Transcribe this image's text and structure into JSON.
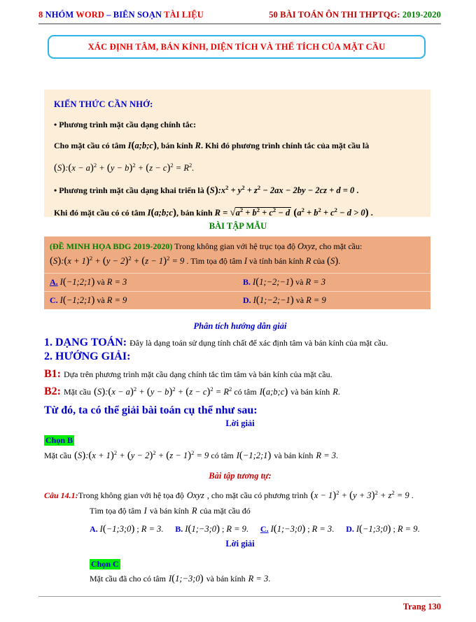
{
  "header": {
    "left_icon": "8",
    "left_part1": "NHÓM",
    "left_part2": "WORD",
    "left_dash": "–",
    "left_part3": "BIÊN SOẠN",
    "left_part4": "TÀI LIỆU",
    "right_main": "50 BÀI TOÁN ÔN THI THPTQG:",
    "right_years": "2019-2020"
  },
  "title_box": {
    "text": "XÁC ĐỊNH TÂM, BÁN KÍNH, DIỆN TÍCH VÀ THỂ TÍCH CỦA MẶT CẦU",
    "border_color": "#2eb2e8",
    "text_color": "#ee0000"
  },
  "knowledge": {
    "heading": "KIẾN THỨC CẦN NHỚ:",
    "bullet1": "• Phương trình mặt cầu dạng chính tắc:",
    "line_center_radius_pre": "Cho mặt cầu có tâm",
    "line_center_I": "I(a;b;c)",
    "line_center_mid": ", bán kính",
    "line_center_R": "R",
    "line_center_post": ". Khi đó phương trình chính tắc của mặt cầu là",
    "equation_canonical": "(S):(x−a)² + (y−b)² + (z−c)² = R².",
    "bullet2_pre": "• Phương trình mặt cầu dạng khai triển là",
    "equation_general": "(S):x² + y² + z² − 2ax − 2by − 2cz + d = 0 .",
    "line3_pre": "Khi đó mặt cầu có có tâm",
    "line3_I": "I(a;b;c)",
    "line3_mid": ", bán kính",
    "line3_R_formula": "R = √(a²+b²+c²−d)",
    "line3_cond": "(a²+b²+c²−d > 0)",
    "line3_end": ".",
    "panel_color": "#fdeed9"
  },
  "sample_section": {
    "heading": "BÀI TẬP MẪU",
    "heading_color": "#008000"
  },
  "problem": {
    "tag": "(ĐỀ MINH HỌA BDG 2019-2020)",
    "statement_line1": "Trong không gian với hệ trục tọa độ",
    "statement_oxyz": "Oxyz",
    "statement_line1b": ", cho mặt cầu:",
    "statement_equation": "(S):(x+1)² + (y−2)² + (z−1)² = 9",
    "statement_line2": ". Tìm tọa độ tâm",
    "statement_I": "I",
    "statement_line2b": "và tính bán kính",
    "statement_R": "R",
    "statement_line2c": "của",
    "statement_S": "(S)",
    "statement_end": ".",
    "box_color": "#eeaa80",
    "options": [
      {
        "key": "A.",
        "center": "I(−1;2;1)",
        "conj": "và",
        "radius": "R = 3",
        "correct": true
      },
      {
        "key": "B.",
        "center": "I(1;−2;−1)",
        "conj": "và",
        "radius": "R = 3",
        "correct": false
      },
      {
        "key": "C.",
        "center": "I(−1;2;1)",
        "conj": "và",
        "radius": "R = 9",
        "correct": false
      },
      {
        "key": "D.",
        "center": "I(1;−2;−1)",
        "conj": "và",
        "radius": "R = 9",
        "correct": false
      }
    ]
  },
  "analysis": {
    "heading": "Phân tích hướng dẫn giải",
    "item1_label": "1. DẠNG TOÁN:",
    "item1_text": "Đây là dạng toán sử dụng tính chất để xác định tâm và bán kính của mặt cầu.",
    "item2_label": "2. HƯỚNG GIẢI:",
    "b1_label": "B1:",
    "b1_text": "Dựa trên phương trình mặt cầu dạng chính tắc tìm tâm và bán kính của mặt cầu.",
    "b2_label": "B2:",
    "b2_text_pre": "Mặt cầu",
    "b2_equation": "(S):(x−a)² + (y−b)² + (z−c)² = R²",
    "b2_text_mid": "có tâm",
    "b2_center": "I(a;b;c)",
    "b2_text_post": "và bán kính",
    "b2_R": "R",
    "b2_end": ".",
    "closing": "Từ đó, ta có thể giải bài toán cụ thể như sau:"
  },
  "solution": {
    "heading": "Lời giải",
    "badge": "Chọn B",
    "badge_bg": "#00ee00",
    "text_pre": "Mặt cầu",
    "equation": "(S):(x+1)² + (y−2)² + (z−1)² = 9",
    "text_mid": "có tâm",
    "center": "I(−1;2;1)",
    "text_post": "và bán kính",
    "radius": "R = 3",
    "text_end": "."
  },
  "similar": {
    "heading": "Bài tập tương tự:",
    "question_label": "Câu 14.1:",
    "question_text1": "Trong không gian với hệ tọa độ",
    "question_oxyz": "Oxyz",
    "question_text1b": ", cho mặt cầu có phương trình",
    "question_equation": "(x−1)² + (y+3)² + z² = 9",
    "question_end": ".",
    "question_text2_pre": "Tìm tọa độ tâm",
    "question_I": "I",
    "question_text2_mid": "và bán kính",
    "question_R": "R",
    "question_text2_post": "của mặt cầu đó",
    "options": [
      {
        "key": "A.",
        "center": "I(−1;3;0)",
        "radius": "R = 3",
        "correct": false
      },
      {
        "key": "B.",
        "center": "I(1;−3;0)",
        "radius": "R = 9",
        "correct": false
      },
      {
        "key": "C.",
        "center": "I(1;−3;0)",
        "radius": "R = 3",
        "correct": true
      },
      {
        "key": "D.",
        "center": "I(−1;3;0)",
        "radius": "R = 9",
        "correct": false
      }
    ],
    "solution_heading": "Lời giải",
    "badge": "Chọn C",
    "solution_text_pre": "Mặt cầu đã cho có tâm",
    "solution_center": "I(1;−3;0)",
    "solution_text_mid": "và bán kính",
    "solution_radius": "R = 3",
    "solution_end": "."
  },
  "footer": {
    "page_label": "Trang 130",
    "color": "#c00000"
  }
}
